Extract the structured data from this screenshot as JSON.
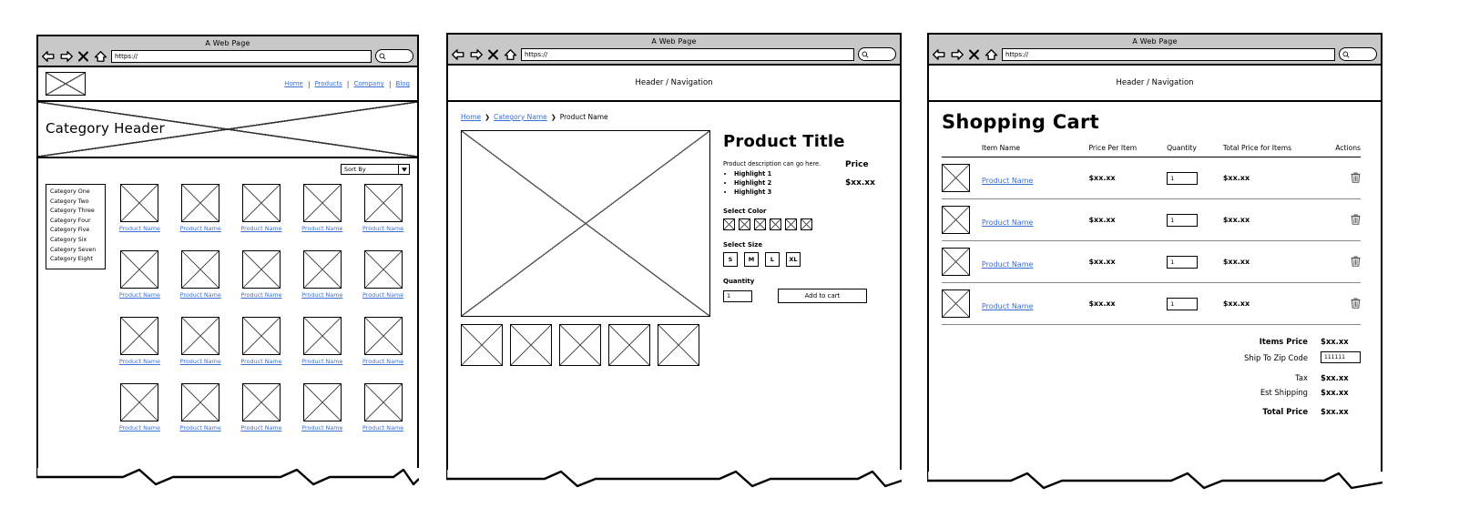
{
  "browser": {
    "title": "A Web Page",
    "url_value": "https://",
    "back_icon": "back-arrow-icon",
    "forward_icon": "forward-arrow-icon",
    "stop_icon": "close-x-icon",
    "home_icon": "home-icon",
    "search_icon": "magnifier-icon",
    "search_value": ""
  },
  "panel1": {
    "logo_alt": "logo-placeholder",
    "nav": [
      {
        "label": "Home"
      },
      {
        "label": "Products"
      },
      {
        "label": "Company"
      },
      {
        "label": "Blog"
      }
    ],
    "nav_separator": "|",
    "hero_alt": "hero-banner-placeholder",
    "category_header": "Category Header",
    "sort": {
      "label": "Sort By",
      "caret": "▼"
    },
    "categories": [
      "Category One",
      "Category Two",
      "Category Three",
      "Category Four",
      "Category Five",
      "Category Six",
      "Category Seven",
      "Category Eight"
    ],
    "product_label": "Product Name",
    "grid": {
      "columns": 5,
      "rows": 4,
      "count": 20
    }
  },
  "panel2": {
    "header_nav": "Header / Navigation",
    "breadcrumb": [
      {
        "label": "Home",
        "link": true
      },
      {
        "label": "Category Name",
        "link": true
      },
      {
        "label": "Product Name",
        "link": false
      }
    ],
    "breadcrumb_separator": "❯",
    "hero_alt": "product-image-placeholder",
    "thumbnails": 5,
    "thumbnail_alt": "product-thumbnail-placeholder",
    "title": "Product Title",
    "description_lead": "Product description can go here.",
    "highlights": [
      "Highlight 1",
      "Highlight 2",
      "Highlight 3"
    ],
    "price_label": "Price",
    "price_value": "$xx.xx",
    "color_label": "Select Color",
    "color_count": 6,
    "size_label": "Select Size",
    "sizes": [
      "S",
      "M",
      "L",
      "XL"
    ],
    "quantity_label": "Quantity",
    "quantity_value": "1",
    "add_to_cart": "Add to cart"
  },
  "panel3": {
    "header_nav": "Header / Navigation",
    "title": "Shopping Cart",
    "columns": [
      "",
      "Item Name",
      "Price Per Item",
      "Quantity",
      "Total Price for Items",
      "Actions"
    ],
    "rows": [
      {
        "thumb": "product-thumbnail-placeholder",
        "name": "Product Name",
        "price": "$xx.xx",
        "qty": "1",
        "total": "$xx.xx",
        "action_icon": "trash-icon"
      },
      {
        "thumb": "product-thumbnail-placeholder",
        "name": "Product Name",
        "price": "$xx.xx",
        "qty": "1",
        "total": "$xx.xx",
        "action_icon": "trash-icon"
      },
      {
        "thumb": "product-thumbnail-placeholder",
        "name": "Product Name",
        "price": "$xx.xx",
        "qty": "1",
        "total": "$xx.xx",
        "action_icon": "trash-icon"
      },
      {
        "thumb": "product-thumbnail-placeholder",
        "name": "Product Name",
        "price": "$xx.xx",
        "qty": "1",
        "total": "$xx.xx",
        "action_icon": "trash-icon"
      }
    ],
    "totals": {
      "items_price_label": "Items Price",
      "items_price_value": "$xx.xx",
      "zip_label": "Ship To Zip Code",
      "zip_value": "111111",
      "tax_label": "Tax",
      "tax_value": "$xx.xx",
      "shipping_label": "Est Shipping",
      "shipping_value": "$xx.xx",
      "total_label": "Total Price",
      "total_value": "$xx.xx"
    }
  },
  "colors": {
    "chrome_bg": "#c8c8c8",
    "link": "#3b6fd4",
    "outline": "#000000",
    "x_stroke": "#555555"
  }
}
